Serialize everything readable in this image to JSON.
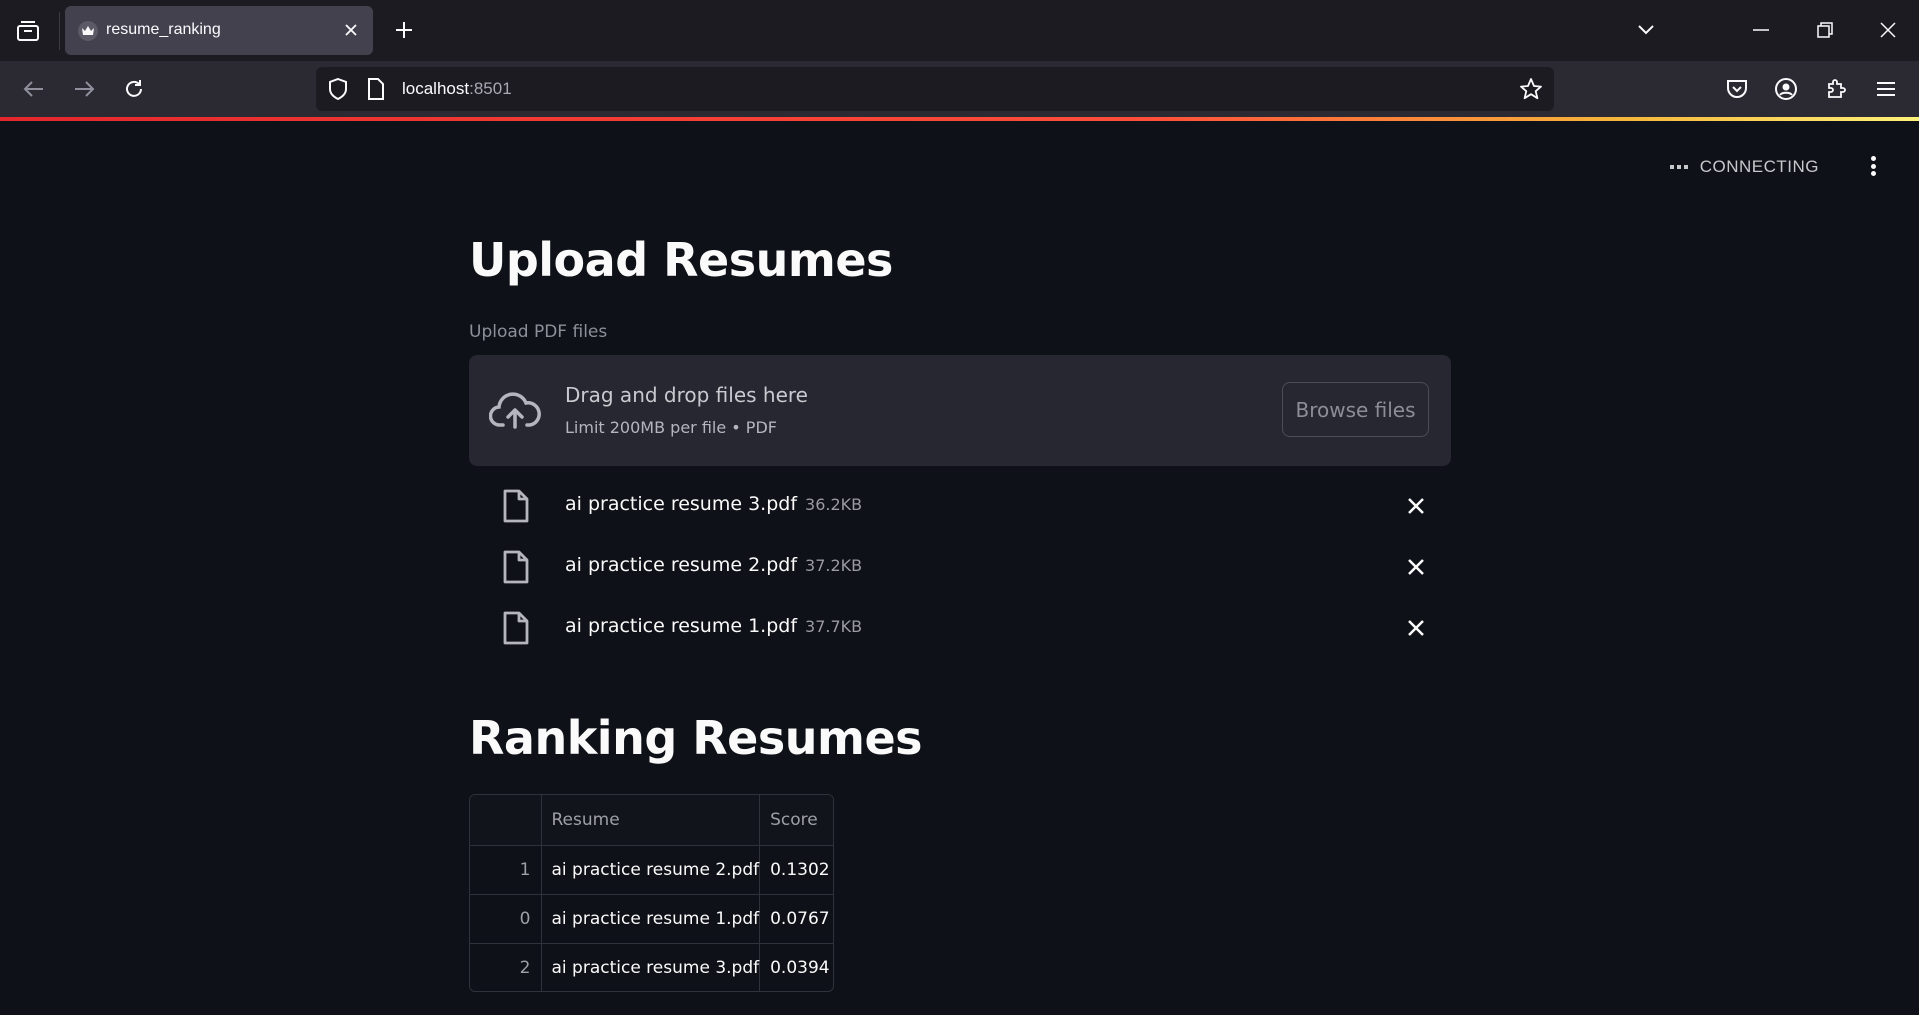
{
  "browser": {
    "tab_title": "resume_ranking",
    "url_host": "localhost",
    "url_port": ":8501"
  },
  "app": {
    "status": "CONNECTING",
    "upload": {
      "title": "Upload Resumes",
      "label": "Upload PDF files",
      "drop_title": "Drag and drop files here",
      "drop_sub": "Limit 200MB per file • PDF",
      "browse_label": "Browse files",
      "files": [
        {
          "name": "ai practice resume 3.pdf",
          "size": "36.2KB"
        },
        {
          "name": "ai practice resume 2.pdf",
          "size": "37.2KB"
        },
        {
          "name": "ai practice resume 1.pdf",
          "size": "37.7KB"
        }
      ]
    },
    "ranking": {
      "title": "Ranking Resumes",
      "columns": [
        "",
        "Resume",
        "Score"
      ],
      "rows": [
        {
          "index": "1",
          "resume": "ai practice resume 2.pdf",
          "score": "0.1302"
        },
        {
          "index": "0",
          "resume": "ai practice resume 1.pdf",
          "score": "0.0767"
        },
        {
          "index": "2",
          "resume": "ai practice resume 3.pdf",
          "score": "0.0394"
        }
      ]
    }
  },
  "colors": {
    "app_bg": "#0e1117",
    "dropzone_bg": "#262730",
    "progress_start": "#e3282d",
    "progress_end": "#fff27a"
  }
}
